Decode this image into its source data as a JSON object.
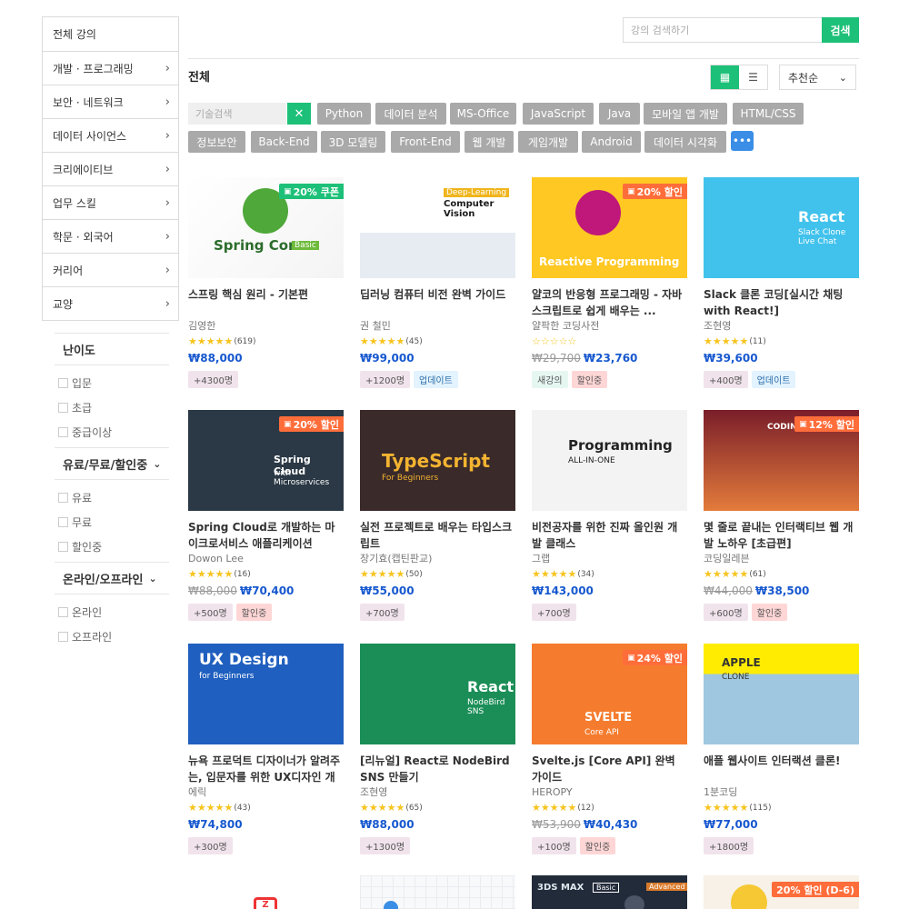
{
  "sidebar": {
    "categories": [
      {
        "label": "전체 강의",
        "arrow": false
      },
      {
        "label": "개발 · 프로그래밍",
        "arrow": true
      },
      {
        "label": "보안 · 네트워크",
        "arrow": true
      },
      {
        "label": "데이터 사이언스",
        "arrow": true
      },
      {
        "label": "크리에이티브",
        "arrow": true
      },
      {
        "label": "업무 스킬",
        "arrow": true
      },
      {
        "label": "학문 · 외국어",
        "arrow": true
      },
      {
        "label": "커리어",
        "arrow": true
      },
      {
        "label": "교양",
        "arrow": true
      }
    ],
    "filters": [
      {
        "title": "난이도",
        "options": [
          "입문",
          "초급",
          "중급이상"
        ]
      },
      {
        "title": "유료/무료/할인중",
        "options": [
          "유료",
          "무료",
          "할인중"
        ]
      },
      {
        "title": "온라인/오프라인",
        "options": [
          "온라인",
          "오프라인"
        ]
      }
    ]
  },
  "header": {
    "search_placeholder": "강의 검색하기",
    "search_button": "검색",
    "section_title": "전체",
    "sort_label": "추천순"
  },
  "tags": {
    "search_placeholder": "기술검색",
    "items": [
      "Python",
      "데이터 분석",
      "MS-Office",
      "JavaScript",
      "Java",
      "모바일 앱 개발",
      "HTML/CSS",
      "정보보안",
      "Back-End",
      "3D 모델링",
      "Front-End",
      "웹 개발",
      "게임개발",
      "Android",
      "데이터 시각화"
    ],
    "more_label": "•••"
  },
  "courses": [
    {
      "title": "스프링 핵심 원리 - 기본편",
      "instructor": "김영한",
      "rating_count": "(619)",
      "price": "₩88,000",
      "old_price": "",
      "discount": "20% 쿠폰",
      "badges": [
        "+4300명"
      ],
      "thumb_text": "Spring Core",
      "thumb_sub": "Basic"
    },
    {
      "title": "딥러닝 컴퓨터 비전 완벽 가이드",
      "instructor": "권 철민",
      "rating_count": "(45)",
      "price": "₩99,000",
      "old_price": "",
      "discount": "",
      "badges": [
        "+1200명",
        "업데이트"
      ],
      "thumb_text": "Computer Vision",
      "thumb_sub": "Deep-Learning"
    },
    {
      "title": "얄코의 반응형 프로그래밍 - 자바스크립트로 쉽게 배우는 ...",
      "instructor": "얄팍한 코딩사전",
      "rating_count": "",
      "price": "₩23,760",
      "old_price": "₩29,700",
      "discount": "20% 할인",
      "badges": [
        "새강의",
        "할인중"
      ],
      "thumb_text": "Reactive Programming",
      "thumb_sub": ""
    },
    {
      "title": "Slack 클론 코딩[실시간 채팅 with React!]",
      "instructor": "조현영",
      "rating_count": "(11)",
      "price": "₩39,600",
      "old_price": "",
      "discount": "",
      "badges": [
        "+400명",
        "업데이트"
      ],
      "thumb_text": "React",
      "thumb_sub": "Slack Clone Live Chat"
    },
    {
      "title": "Spring Cloud로 개발하는 마이크로서비스 애플리케이션",
      "instructor": "Dowon Lee",
      "rating_count": "(16)",
      "price": "₩70,400",
      "old_price": "₩88,000",
      "discount": "20% 할인",
      "badges": [
        "+500명",
        "할인중"
      ],
      "thumb_text": "Spring Cloud",
      "thumb_sub": "with Microservices"
    },
    {
      "title": "실전 프로젝트로 배우는 타입스크립트",
      "instructor": "장기효(캡틴판교)",
      "rating_count": "(50)",
      "price": "₩55,000",
      "old_price": "",
      "discount": "",
      "badges": [
        "+700명"
      ],
      "thumb_text": "TypeScript",
      "thumb_sub": "For Beginners"
    },
    {
      "title": "비전공자를 위한 진짜 올인원 개발 클래스",
      "instructor": "그랩",
      "rating_count": "(34)",
      "price": "₩143,000",
      "old_price": "",
      "discount": "",
      "badges": [
        "+700명"
      ],
      "thumb_text": "Programming",
      "thumb_sub": "ALL-IN-ONE"
    },
    {
      "title": "몇 줄로 끝내는 인터랙티브 웹 개발 노하우 [초급편]",
      "instructor": "코딩일레븐",
      "rating_count": "(61)",
      "price": "₩38,500",
      "old_price": "₩44,000",
      "discount": "12% 할인",
      "badges": [
        "+600명",
        "할인중"
      ],
      "thumb_text": "CODING ELEVEN",
      "thumb_sub": ""
    },
    {
      "title": "뉴욕 프로덕트 디자이너가 알려주는, 입문자를 위한 UX디자인 개론",
      "instructor": "에릭",
      "rating_count": "(43)",
      "price": "₩74,800",
      "old_price": "",
      "discount": "",
      "badges": [
        "+300명"
      ],
      "thumb_text": "UX Design",
      "thumb_sub": "for Beginners"
    },
    {
      "title": "[리뉴얼] React로 NodeBird SNS 만들기",
      "instructor": "조현영",
      "rating_count": "(65)",
      "price": "₩88,000",
      "old_price": "",
      "discount": "",
      "badges": [
        "+1300명"
      ],
      "thumb_text": "React",
      "thumb_sub": "NodeBird SNS"
    },
    {
      "title": "Svelte.js [Core API] 완벽 가이드",
      "instructor": "HEROPY",
      "rating_count": "(12)",
      "price": "₩40,430",
      "old_price": "₩53,900",
      "discount": "24% 할인",
      "badges": [
        "+100명",
        "할인중"
      ],
      "thumb_text": "SVELTE",
      "thumb_sub": "Core API"
    },
    {
      "title": "애플 웹사이트 인터랙션 클론!",
      "instructor": "1분코딩",
      "rating_count": "(115)",
      "price": "₩77,000",
      "old_price": "",
      "discount": "",
      "badges": [
        "+1800명"
      ],
      "thumb_text": "APPLE",
      "thumb_sub": "CLONE"
    }
  ],
  "partial_row": {
    "thumb3_text": "3DS MAX",
    "thumb3_tag1": "Basic",
    "thumb3_tag2": "Advanced",
    "thumb4_discount": "20% 할인 (D-6)"
  },
  "colors": {
    "accent": "#1dc078",
    "price": "#1758cf",
    "tag": "#a9a9a9",
    "star": "#f7c41f"
  }
}
